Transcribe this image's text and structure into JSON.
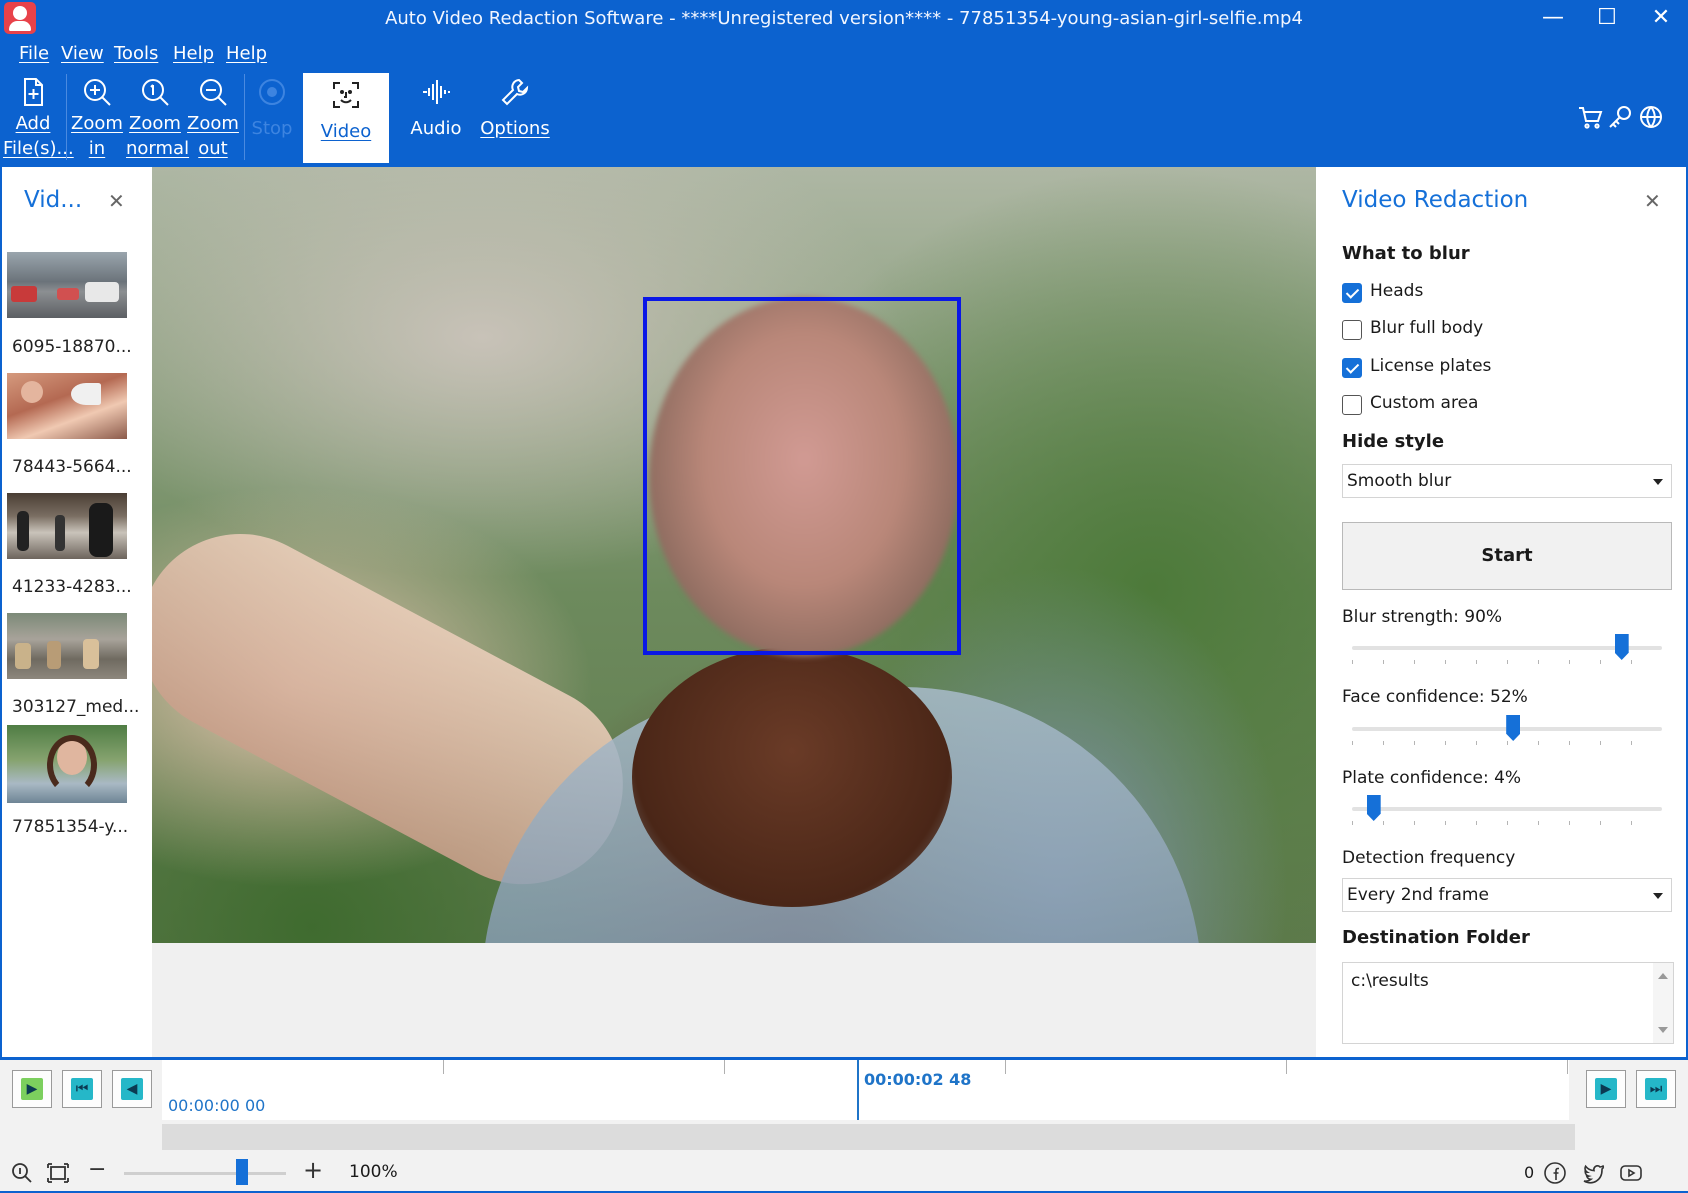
{
  "window": {
    "title": "Auto Video Redaction Software - ****Unregistered version**** - 77851354-young-asian-girl-selfie.mp4",
    "minimize": "—",
    "maximize": "☐",
    "close": "✕"
  },
  "menu": [
    "File",
    "View",
    "Tools",
    "Help",
    "Help"
  ],
  "toolbar": {
    "add_line1": "Add",
    "add_line2": "File(s)...",
    "zoom_in_line1": "Zoom",
    "zoom_in_line2": "in",
    "zoom_normal_line1": "Zoom",
    "zoom_normal_line2": "normal",
    "zoom_out_line1": "Zoom",
    "zoom_out_line2": "out",
    "stop": "Stop",
    "video": "Video",
    "audio": "Audio",
    "options": "Options"
  },
  "left_panel": {
    "title": "Vid...",
    "close": "✕",
    "items": [
      {
        "label": "6095-18870..."
      },
      {
        "label": "78443-5664..."
      },
      {
        "label": "41233-4283..."
      },
      {
        "label": "303127_med..."
      },
      {
        "label": "77851354-y..."
      }
    ]
  },
  "right_panel": {
    "title": "Video Redaction",
    "close": "✕",
    "what_to_blur": "What to blur",
    "options": [
      {
        "label": "Heads",
        "checked": true
      },
      {
        "label": "Blur full body",
        "checked": false
      },
      {
        "label": "License plates",
        "checked": true
      },
      {
        "label": "Custom area",
        "checked": false
      }
    ],
    "hide_style_label": "Hide style",
    "hide_style_value": "Smooth blur",
    "start_label": "Start",
    "blur_strength_label": "Blur strength: 90%",
    "blur_strength": 0.87,
    "face_conf_label": "Face confidence: 52%",
    "face_conf": 0.52,
    "plate_conf_label": "Plate confidence: 4%",
    "plate_conf": 0.07,
    "detection_label": "Detection frequency",
    "detection_value": "Every 2nd frame",
    "dest_label": "Destination Folder",
    "dest_value": "c:\\results"
  },
  "timeline": {
    "start_time": "00:00:00 00",
    "cursor_time": "00:00:02 48",
    "glyphs": {
      "play": "▶",
      "rewind": "⏮",
      "step_back": "◀",
      "step_fwd": "▶",
      "fast_fwd": "⏭"
    }
  },
  "statusbar": {
    "zoom_minus": "−",
    "zoom_plus": "+",
    "zoom_value": "100%",
    "count": "0"
  },
  "colors": {
    "accent": "#0c62cf",
    "face_box": "#0a17e6",
    "link_blue": "#1570d8"
  }
}
